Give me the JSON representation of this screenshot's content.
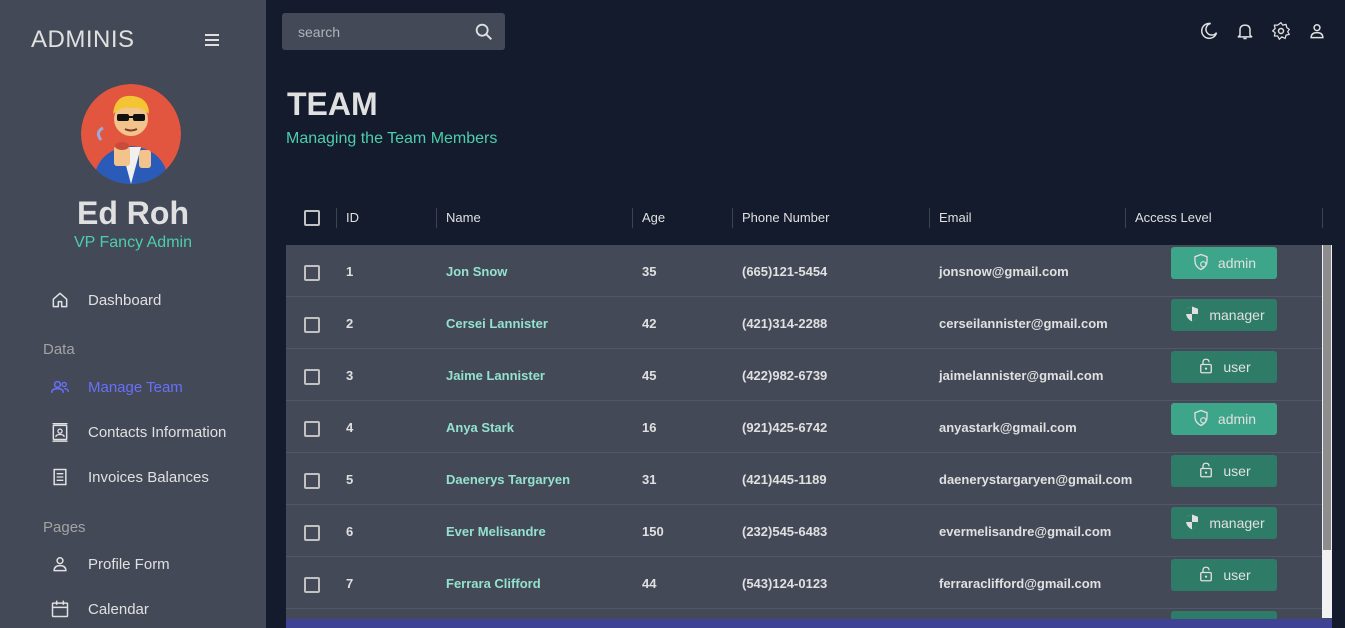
{
  "sidebar": {
    "brand": "ADMINIS",
    "profile": {
      "name": "Ed Roh",
      "role": "VP Fancy Admin"
    },
    "items": [
      {
        "label": "Dashboard",
        "icon": "home-icon"
      },
      {
        "section": "Data"
      },
      {
        "label": "Manage Team",
        "icon": "people-icon",
        "active": true
      },
      {
        "label": "Contacts Information",
        "icon": "contacts-icon"
      },
      {
        "label": "Invoices Balances",
        "icon": "receipt-icon"
      },
      {
        "section": "Pages"
      },
      {
        "label": "Profile Form",
        "icon": "person-icon"
      },
      {
        "label": "Calendar",
        "icon": "calendar-icon"
      }
    ]
  },
  "topbar": {
    "search_placeholder": "search",
    "icons": [
      "dark-mode-icon",
      "notifications-icon",
      "settings-icon",
      "account-icon"
    ]
  },
  "header": {
    "title": "TEAM",
    "subtitle": "Managing the Team Members"
  },
  "table": {
    "columns": [
      "ID",
      "Name",
      "Age",
      "Phone Number",
      "Email",
      "Access Level"
    ],
    "rows": [
      {
        "id": "1",
        "name": "Jon Snow",
        "age": "35",
        "phone": "(665)121-5454",
        "email": "jonsnow@gmail.com",
        "access": "admin"
      },
      {
        "id": "2",
        "name": "Cersei Lannister",
        "age": "42",
        "phone": "(421)314-2288",
        "email": "cerseilannister@gmail.com",
        "access": "manager"
      },
      {
        "id": "3",
        "name": "Jaime Lannister",
        "age": "45",
        "phone": "(422)982-6739",
        "email": "jaimelannister@gmail.com",
        "access": "user"
      },
      {
        "id": "4",
        "name": "Anya Stark",
        "age": "16",
        "phone": "(921)425-6742",
        "email": "anyastark@gmail.com",
        "access": "admin"
      },
      {
        "id": "5",
        "name": "Daenerys Targaryen",
        "age": "31",
        "phone": "(421)445-1189",
        "email": "daenerystargaryen@gmail.com",
        "access": "user"
      },
      {
        "id": "6",
        "name": "Ever Melisandre",
        "age": "150",
        "phone": "(232)545-6483",
        "email": "evermelisandre@gmail.com",
        "access": "manager"
      },
      {
        "id": "7",
        "name": "Ferrara Clifford",
        "age": "44",
        "phone": "(543)124-0123",
        "email": "ferraraclifford@gmail.com",
        "access": "user"
      }
    ]
  },
  "colors": {
    "accent_green": "#4cceac",
    "active_nav": "#6870fa",
    "admin_badge": "#3da58a",
    "badge": "#2e7c67"
  }
}
